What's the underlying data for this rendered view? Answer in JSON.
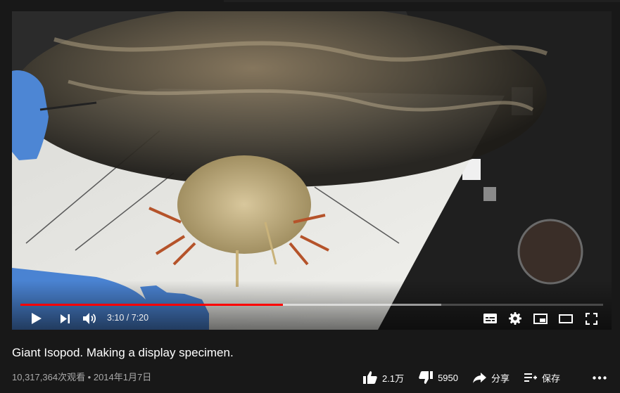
{
  "player": {
    "time_display": "3:10 / 7:20",
    "played_fraction": 0.4505,
    "buffered_fraction": 0.7222
  },
  "video": {
    "title": "Giant Isopod. Making a display specimen.",
    "views_date": "10,317,364次观看 • 2014年1月7日"
  },
  "actions": {
    "like_count": "2.1万",
    "dislike_count": "5950",
    "share_label": "分享",
    "save_label": "保存"
  },
  "colors": {
    "background": "#181818",
    "progress_played": "#ff0000",
    "secondary_text": "#aaaaaa"
  },
  "icons": [
    "play-icon",
    "next-icon",
    "volume-icon",
    "subtitles-icon",
    "settings-icon",
    "miniplayer-icon",
    "theater-icon",
    "fullscreen-icon",
    "thumbs-up-icon",
    "thumbs-down-icon",
    "share-icon",
    "save-playlist-icon",
    "more-icon"
  ]
}
